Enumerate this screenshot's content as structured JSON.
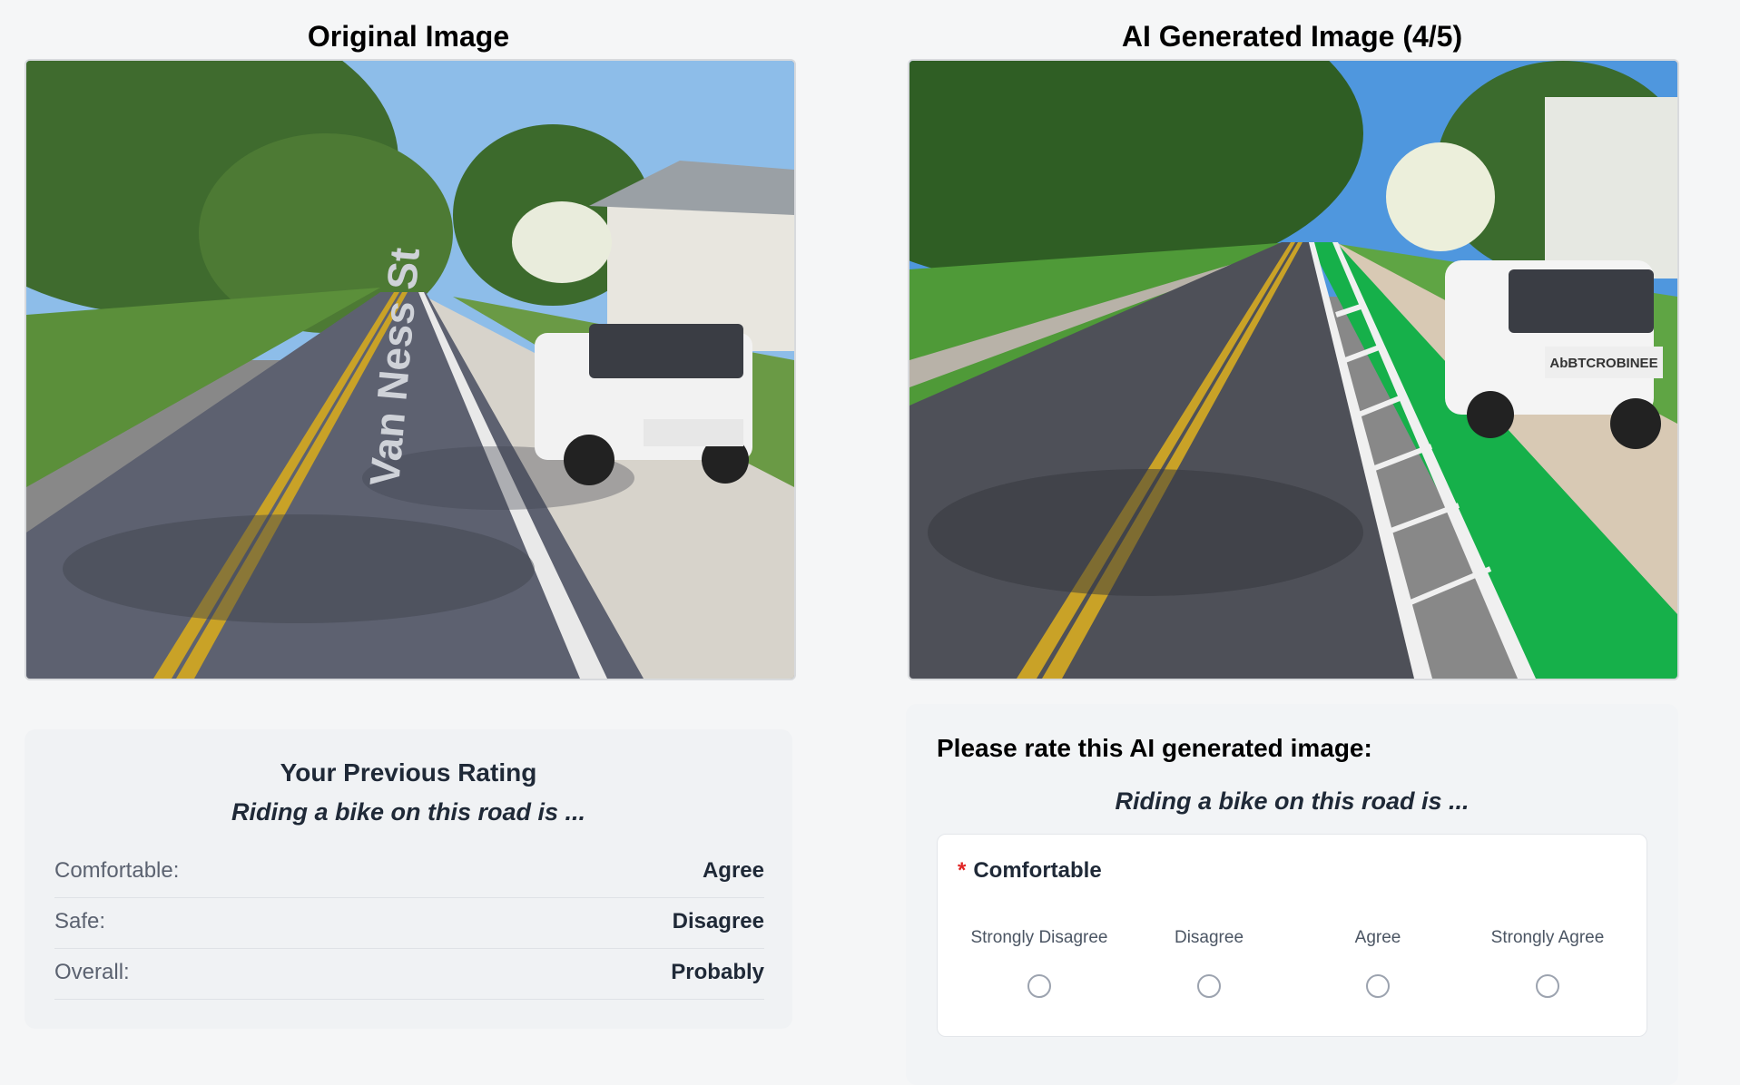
{
  "original": {
    "title": "Original Image",
    "street_label": "Van Ness St"
  },
  "generated": {
    "title": "AI Generated Image (4/5)",
    "truck_label": "AbBTCROBINEE"
  },
  "previous": {
    "title": "Your Previous Rating",
    "subtitle": "Riding a bike on this road is ...",
    "rows": [
      {
        "label": "Comfortable:",
        "value": "Agree"
      },
      {
        "label": "Safe:",
        "value": "Disagree"
      },
      {
        "label": "Overall:",
        "value": "Probably"
      }
    ]
  },
  "rate": {
    "title": "Please rate this AI generated image:",
    "subtitle": "Riding a bike on this road is ...",
    "question": {
      "required_mark": "*",
      "label": "Comfortable"
    },
    "options": [
      "Strongly Disagree",
      "Disagree",
      "Agree",
      "Strongly Agree"
    ]
  },
  "colors": {
    "bike_lane": "#16b04a",
    "road": "#5a5d68",
    "sky": "#7fb3e8"
  }
}
